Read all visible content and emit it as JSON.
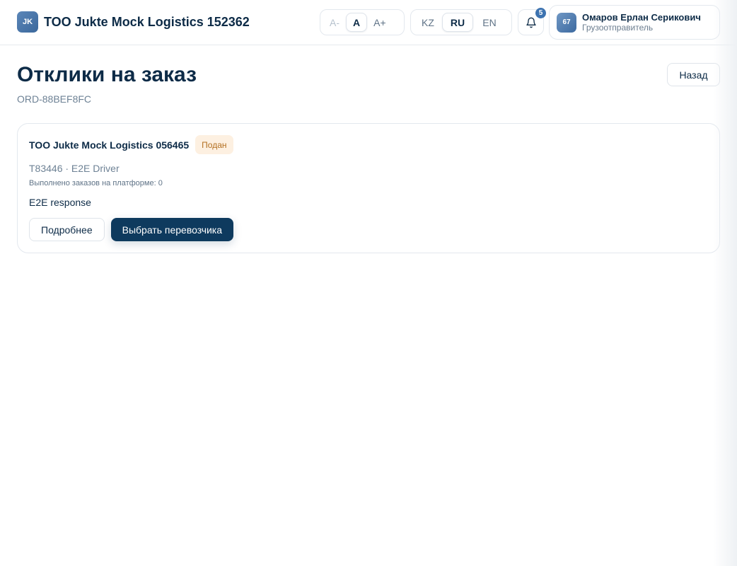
{
  "header": {
    "logo_initials": "JK",
    "company_title": "TOO Jukte Mock Logistics 152362",
    "font_size": {
      "decrease_label": "A-",
      "normal_label": "A",
      "increase_label": "A+",
      "active": "A"
    },
    "languages": {
      "options": [
        "KZ",
        "RU",
        "EN"
      ],
      "active": "RU"
    },
    "notifications": {
      "icon": "bell-icon",
      "count": "5"
    },
    "user": {
      "avatar_initials": "67",
      "name": "Омаров Ерлан Серикович",
      "role": "Грузоотправитель"
    }
  },
  "page": {
    "title": "Отклики на заказ",
    "order_id": "ORD-88BEF8FC",
    "back_label": "Назад"
  },
  "responses": [
    {
      "company": "TOO Jukte Mock Logistics 056465",
      "status": "Подан",
      "driver": "T83446 · E2E Driver",
      "completed_orders": "Выполнено заказов на платформе: 0",
      "message": "E2E response",
      "details_label": "Подробнее",
      "select_label": "Выбрать перевозчика"
    }
  ],
  "colors": {
    "primary": "#0e3a5e",
    "accent": "#3d73b0",
    "status_bg": "#fdf0e1",
    "status_text": "#b36f20"
  }
}
